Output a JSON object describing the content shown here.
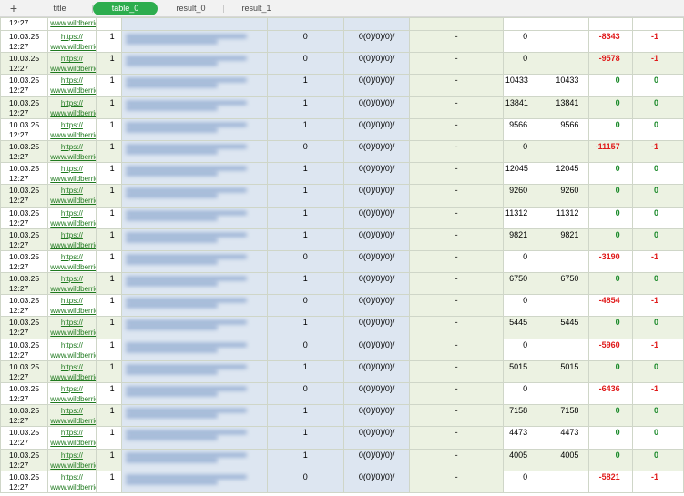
{
  "tabs": {
    "add": "+",
    "items": [
      {
        "label": "title",
        "active": false
      },
      {
        "label": "table_0",
        "active": true
      },
      {
        "label": "result_0",
        "active": false
      },
      {
        "label": "result_1",
        "active": false
      }
    ]
  },
  "top_partial": {
    "time": "12:27",
    "link": "www.wildberrie"
  },
  "rows": [
    {
      "date": "10.03.25",
      "time": "12:27",
      "link1": "https://",
      "link2": "www.wildberrie",
      "qty": "1",
      "flag": "0",
      "code": "0(0)/0)/0)/",
      "dash": "-",
      "v1": "0",
      "v2": "",
      "v3": "-8343",
      "v4": "-1"
    },
    {
      "date": "10.03.25",
      "time": "12:27",
      "link1": "https://",
      "link2": "www.wildberrie",
      "qty": "1",
      "flag": "0",
      "code": "0(0)/0)/0)/",
      "dash": "-",
      "v1": "0",
      "v2": "",
      "v3": "-9578",
      "v4": "-1"
    },
    {
      "date": "10.03.25",
      "time": "12:27",
      "link1": "https://",
      "link2": "www.wildberrie",
      "qty": "1",
      "flag": "1",
      "code": "0(0)/0)/0)/",
      "dash": "-",
      "v1": "10433",
      "v2": "10433",
      "v3": "0",
      "v4": "0"
    },
    {
      "date": "10.03.25",
      "time": "12:27",
      "link1": "https://",
      "link2": "www.wildberrie",
      "qty": "1",
      "flag": "1",
      "code": "0(0)/0)/0)/",
      "dash": "-",
      "v1": "13841",
      "v2": "13841",
      "v3": "0",
      "v4": "0"
    },
    {
      "date": "10.03.25",
      "time": "12:27",
      "link1": "https://",
      "link2": "www.wildberrie",
      "qty": "1",
      "flag": "1",
      "code": "0(0)/0)/0)/",
      "dash": "-",
      "v1": "9566",
      "v2": "9566",
      "v3": "0",
      "v4": "0"
    },
    {
      "date": "10.03.25",
      "time": "12:27",
      "link1": "https://",
      "link2": "www.wildberrie",
      "qty": "1",
      "flag": "0",
      "code": "0(0)/0)/0)/",
      "dash": "-",
      "v1": "0",
      "v2": "",
      "v3": "-11157",
      "v4": "-1"
    },
    {
      "date": "10.03.25",
      "time": "12:27",
      "link1": "https://",
      "link2": "www.wildberrie",
      "qty": "1",
      "flag": "1",
      "code": "0(0)/0)/0)/",
      "dash": "-",
      "v1": "12045",
      "v2": "12045",
      "v3": "0",
      "v4": "0"
    },
    {
      "date": "10.03.25",
      "time": "12:27",
      "link1": "https://",
      "link2": "www.wildberrie",
      "qty": "1",
      "flag": "1",
      "code": "0(0)/0)/0)/",
      "dash": "-",
      "v1": "9260",
      "v2": "9260",
      "v3": "0",
      "v4": "0"
    },
    {
      "date": "10.03.25",
      "time": "12:27",
      "link1": "https://",
      "link2": "www.wildberrie",
      "qty": "1",
      "flag": "1",
      "code": "0(0)/0)/0)/",
      "dash": "-",
      "v1": "11312",
      "v2": "11312",
      "v3": "0",
      "v4": "0"
    },
    {
      "date": "10.03.25",
      "time": "12:27",
      "link1": "https://",
      "link2": "www.wildberrie",
      "qty": "1",
      "flag": "1",
      "code": "0(0)/0)/0)/",
      "dash": "-",
      "v1": "9821",
      "v2": "9821",
      "v3": "0",
      "v4": "0"
    },
    {
      "date": "10.03.25",
      "time": "12:27",
      "link1": "https://",
      "link2": "www.wildberrie",
      "qty": "1",
      "flag": "0",
      "code": "0(0)/0)/0)/",
      "dash": "-",
      "v1": "0",
      "v2": "",
      "v3": "-3190",
      "v4": "-1"
    },
    {
      "date": "10.03.25",
      "time": "12:27",
      "link1": "https://",
      "link2": "www.wildberrie",
      "qty": "1",
      "flag": "1",
      "code": "0(0)/0)/0)/",
      "dash": "-",
      "v1": "6750",
      "v2": "6750",
      "v3": "0",
      "v4": "0"
    },
    {
      "date": "10.03.25",
      "time": "12:27",
      "link1": "https://",
      "link2": "www.wildberrie",
      "qty": "1",
      "flag": "0",
      "code": "0(0)/0)/0)/",
      "dash": "-",
      "v1": "0",
      "v2": "",
      "v3": "-4854",
      "v4": "-1"
    },
    {
      "date": "10.03.25",
      "time": "12:27",
      "link1": "https://",
      "link2": "www.wildberrie",
      "qty": "1",
      "flag": "1",
      "code": "0(0)/0)/0)/",
      "dash": "-",
      "v1": "5445",
      "v2": "5445",
      "v3": "0",
      "v4": "0"
    },
    {
      "date": "10.03.25",
      "time": "12:27",
      "link1": "https://",
      "link2": "www.wildberrie",
      "qty": "1",
      "flag": "0",
      "code": "0(0)/0)/0)/",
      "dash": "-",
      "v1": "0",
      "v2": "",
      "v3": "-5960",
      "v4": "-1"
    },
    {
      "date": "10.03.25",
      "time": "12:27",
      "link1": "https://",
      "link2": "www.wildberrie",
      "qty": "1",
      "flag": "1",
      "code": "0(0)/0)/0)/",
      "dash": "-",
      "v1": "5015",
      "v2": "5015",
      "v3": "0",
      "v4": "0"
    },
    {
      "date": "10.03.25",
      "time": "12:27",
      "link1": "https://",
      "link2": "www.wildberrie",
      "qty": "1",
      "flag": "0",
      "code": "0(0)/0)/0)/",
      "dash": "-",
      "v1": "0",
      "v2": "",
      "v3": "-6436",
      "v4": "-1"
    },
    {
      "date": "10.03.25",
      "time": "12:27",
      "link1": "https://",
      "link2": "www.wildberrie",
      "qty": "1",
      "flag": "1",
      "code": "0(0)/0)/0)/",
      "dash": "-",
      "v1": "7158",
      "v2": "7158",
      "v3": "0",
      "v4": "0"
    },
    {
      "date": "10.03.25",
      "time": "12:27",
      "link1": "https://",
      "link2": "www.wildberrie",
      "qty": "1",
      "flag": "1",
      "code": "0(0)/0)/0)/",
      "dash": "-",
      "v1": "4473",
      "v2": "4473",
      "v3": "0",
      "v4": "0"
    },
    {
      "date": "10.03.25",
      "time": "12:27",
      "link1": "https://",
      "link2": "www.wildberrie",
      "qty": "1",
      "flag": "1",
      "code": "0(0)/0)/0)/",
      "dash": "-",
      "v1": "4005",
      "v2": "4005",
      "v3": "0",
      "v4": "0"
    },
    {
      "date": "10.03.25",
      "time": "12:27",
      "link1": "https://",
      "link2": "www.wildberrie",
      "qty": "1",
      "flag": "0",
      "code": "0(0)/0)/0)/",
      "dash": "-",
      "v1": "0",
      "v2": "",
      "v3": "-5821",
      "v4": "-1"
    }
  ],
  "colors": {
    "accent": "#2dad4e",
    "negative": "#e01b1b",
    "positive": "#1b8a2a",
    "link": "#1f7a1f",
    "blurred_fill": "#dde6f1",
    "alt_row": "#ecf2e2"
  }
}
